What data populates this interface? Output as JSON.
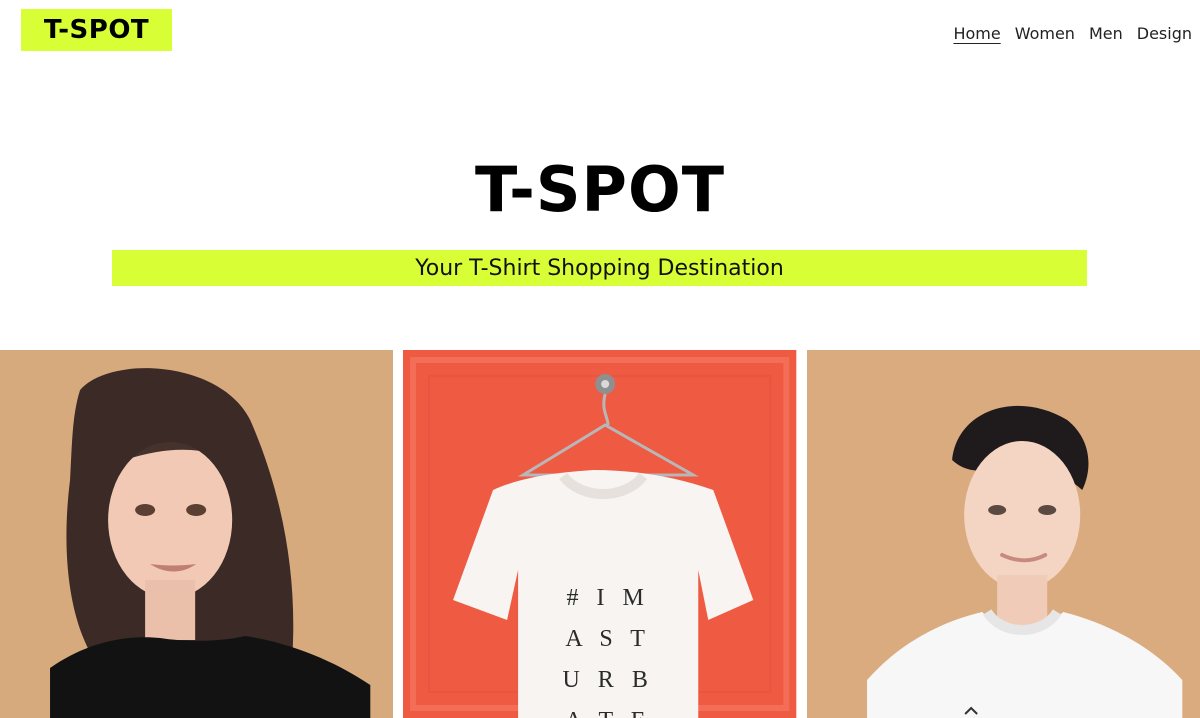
{
  "header": {
    "logo_text": "T-SPOT",
    "nav": [
      {
        "label": "Home",
        "active": true
      },
      {
        "label": "Women",
        "active": false
      },
      {
        "label": "Men",
        "active": false
      },
      {
        "label": "Design",
        "active": false
      }
    ]
  },
  "hero": {
    "title": "T-SPOT",
    "tagline": "Your T-Shirt Shopping Destination"
  },
  "gallery": {
    "tiles": [
      {
        "name": "women-model-photo",
        "bg": "#d7aa7d"
      },
      {
        "name": "tshirt-hanger-photo",
        "bg": "#ef5a43",
        "shirt_text_lines": [
          "# I M",
          "A S T",
          "U R B",
          "A T E"
        ]
      },
      {
        "name": "men-model-photo",
        "bg": "#d9ab7f"
      }
    ]
  },
  "colors": {
    "accent": "#d8ff36",
    "text": "#111111"
  }
}
